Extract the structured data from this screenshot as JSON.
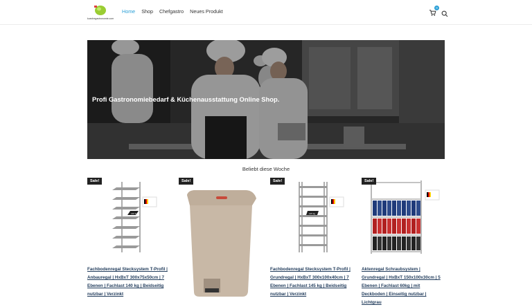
{
  "header": {
    "logo_text": "kuechegastronomie.com",
    "nav": [
      "Home",
      "Shop",
      "Chefgastro",
      "Neues Produkt"
    ],
    "cart_count": "0"
  },
  "hero": {
    "title": "Profi Gastronomiebedarf & Küchenausstattung Online Shop."
  },
  "section_title": "Beliebt diese Woche",
  "sale_label": "Sale!",
  "products": [
    {
      "title": "Fachbodenregal Stecksystem T-Profil | Anbauregal | HxBxT 300x75x50cm | 7 Ebenen | Fachlast 140 kg | Beidseitig nutzbar | Verzinkt"
    },
    {
      "title": ""
    },
    {
      "title": "Fachbodenregal Stecksystem T-Profil | Grundregal | HxBxT 300x100x40cm | 7 Ebenen | Fachlast 145 kg | Beidseitig nutzbar | Verzinkt"
    },
    {
      "title": "Aktenregal Schraubsystem | Grundregal | HxBxT 150x100x30cm | 5 Ebenen | Fachlast 60kg | mit Deckboden | Einseitig nutzbar | Lichtgrau"
    }
  ],
  "colors": {
    "accent": "#2a9fd6",
    "link": "#1f3a5a",
    "badge_bg": "#222222"
  }
}
